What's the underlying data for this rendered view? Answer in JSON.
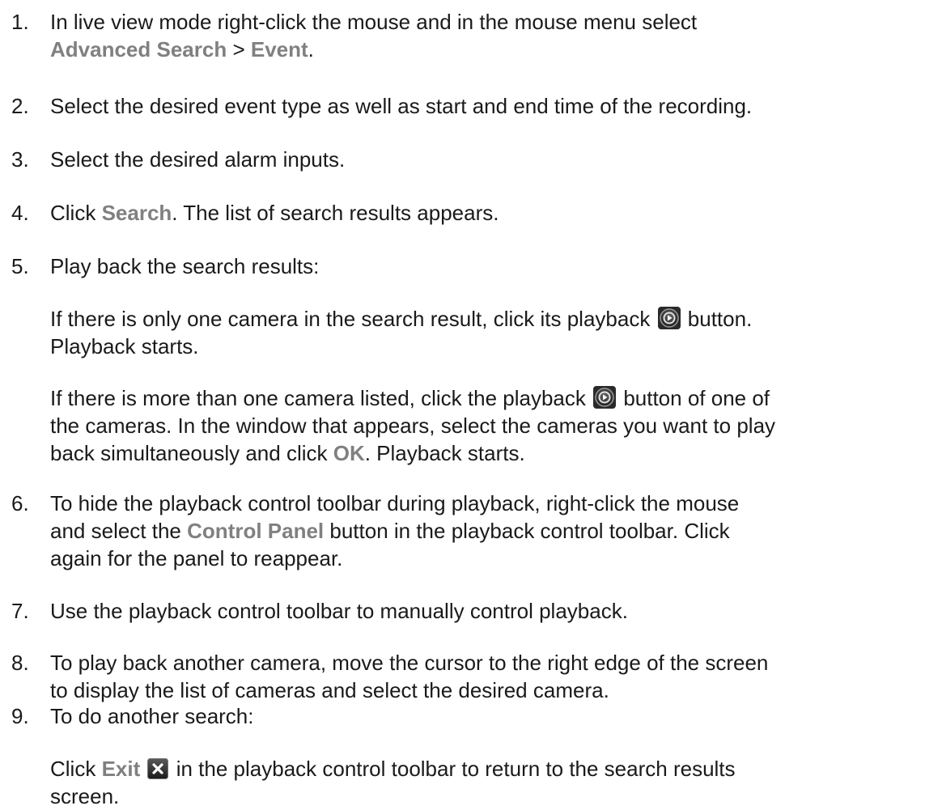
{
  "steps": [
    {
      "number": "1.",
      "line1": "In live view mode right-click the mouse and in the mouse menu select",
      "ui1": "Advanced Search",
      "sep": " > ",
      "ui2": "Event",
      "end": "."
    },
    {
      "number": "2.",
      "text": "Select the desired event type as well as start and end time of the recording."
    },
    {
      "number": "3.",
      "text": "Select the desired alarm inputs."
    },
    {
      "number": "4.",
      "pre": "Click ",
      "ui": "Search",
      "post": ". The list of search results appears."
    },
    {
      "number": "5.",
      "text": "Play back the search results:",
      "sub1": {
        "line1_pre": "If there is only one camera in the search result, click its playback ",
        "line1_post": " button.",
        "line2": "Playback starts."
      },
      "sub2": {
        "line1_pre": "If there is more than one camera listed, click the playback ",
        "line1_post": " button of one of",
        "line2": "the cameras. In the window that appears, select the cameras you want to play",
        "line3_pre": "back simultaneously and click ",
        "line3_ui": "OK",
        "line3_post": ". Playback starts."
      }
    },
    {
      "number": "6.",
      "line1": "To hide the playback control toolbar during playback, right-click the mouse",
      "line2_pre": "and select the ",
      "line2_ui": "Control Panel",
      "line2_post": " button in the playback control toolbar. Click",
      "line3": "again for the panel to reappear."
    },
    {
      "number": "7.",
      "text": "Use the playback control toolbar to manually control playback."
    },
    {
      "number": "8.",
      "line1": "To play back another camera, move the cursor to the right edge of the screen",
      "line2": "to display the list of cameras and select the desired camera."
    },
    {
      "number": "9.",
      "text": "To do another search:",
      "sub": {
        "line1_pre": "Click ",
        "line1_ui": "Exit",
        "line1_post": " in the playback control toolbar to return to the search results",
        "line2": "screen."
      }
    }
  ],
  "icons": {
    "playback": "playback-icon",
    "exit": "exit-icon"
  },
  "colors": {
    "text": "#1a1a1a",
    "ui_term": "#808080"
  }
}
